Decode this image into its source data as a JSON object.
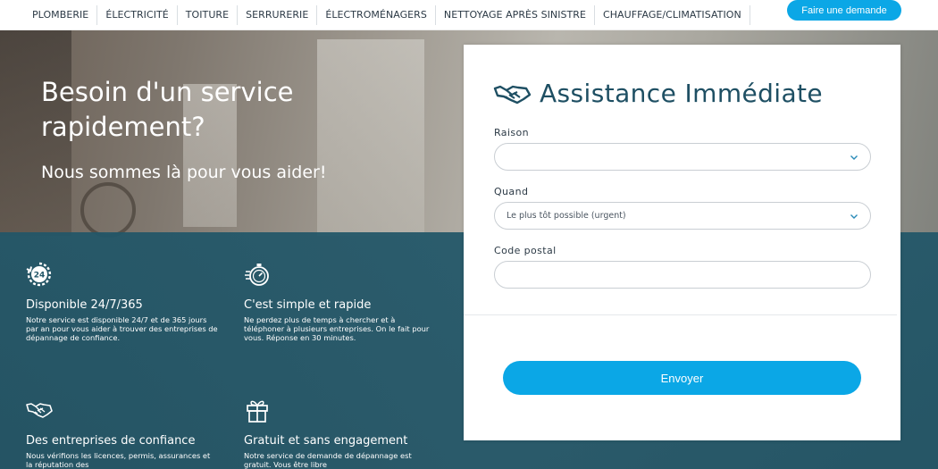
{
  "nav": {
    "items": [
      "PLOMBERIE",
      "ÉLECTRICITÉ",
      "TOITURE",
      "SERRURERIE",
      "ÉLECTROMÉNAGERS",
      "NETTOYAGE APRÈS SINISTRE",
      "CHAUFFAGE/CLIMATISATION"
    ],
    "cta": "Faire une demande"
  },
  "hero": {
    "title": "Besoin d'un service rapidement?",
    "subtitle": "Nous sommes là pour vous aider!"
  },
  "features": [
    {
      "icon": "clock-24-icon",
      "title": "Disponible 24/7/365",
      "desc": "Notre service est disponible 24/7 et de 365 jours par an pour vous aider à trouver des entreprises de dépannage de confiance."
    },
    {
      "icon": "stopwatch-icon",
      "title": "C'est simple et rapide",
      "desc": "Ne perdez plus de temps à chercher et à téléphoner à plusieurs entreprises. On le fait pour vous. Réponse en 30 minutes."
    },
    {
      "icon": "handshake-icon",
      "title": "Des entreprises de confiance",
      "desc": "Nous vérifions les licences, permis, assurances et la réputation des"
    },
    {
      "icon": "gift-icon",
      "title": "Gratuit et sans engagement",
      "desc": "Notre service de demande de dépannage est gratuit. Vous être libre"
    }
  ],
  "form": {
    "title": "Assistance Immédiate",
    "icon": "handshake-icon",
    "fields": {
      "raison": {
        "label": "Raison",
        "value": ""
      },
      "quand": {
        "label": "Quand",
        "value": "Le plus tôt possible (urgent)"
      },
      "code_postal": {
        "label": "Code postal",
        "value": ""
      }
    },
    "submit": "Envoyer"
  },
  "colors": {
    "accent": "#0ba7e6",
    "teal_overlay": "#215668",
    "title_text": "#1e4f63"
  }
}
